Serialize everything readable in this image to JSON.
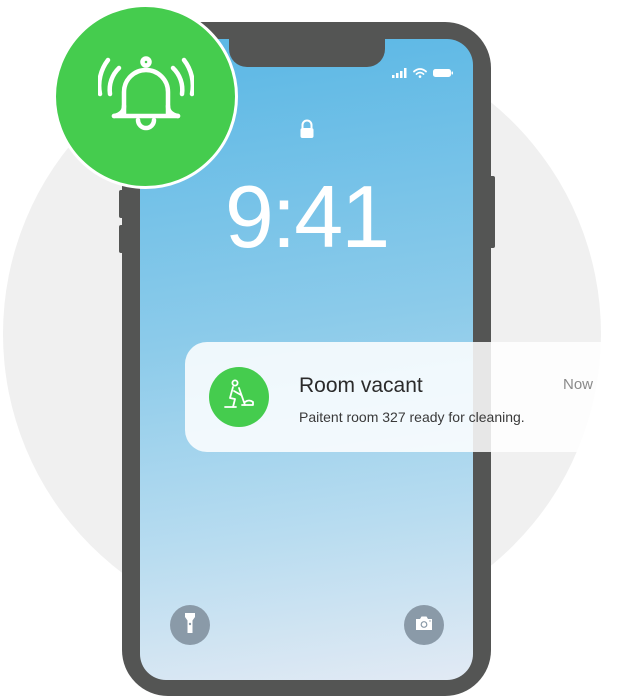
{
  "lockscreen": {
    "time": "9:41"
  },
  "notification": {
    "title": "Room vacant",
    "time": "Now",
    "body": "Paitent room 327 ready for cleaning.",
    "icon": "cleaning-person-icon",
    "icon_color": "#45cc4e"
  },
  "alarm_badge": {
    "icon": "ringing-bell-icon",
    "color": "#45cc4e"
  },
  "quick_actions": {
    "left_icon": "flashlight-icon",
    "right_icon": "camera-icon"
  },
  "status_bar": {
    "icons": [
      "cellular-signal-icon",
      "wifi-icon",
      "battery-icon"
    ]
  }
}
